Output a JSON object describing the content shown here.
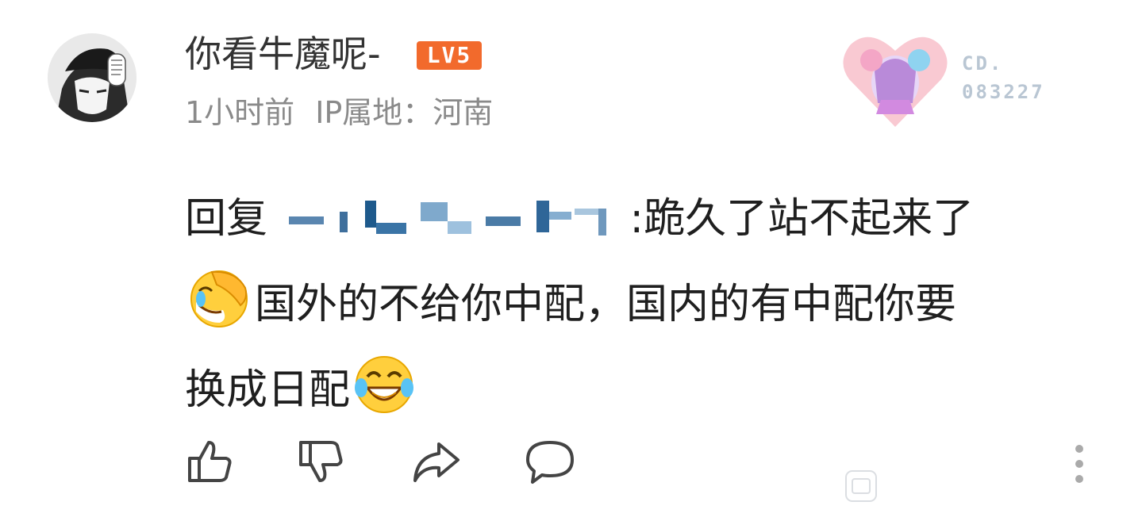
{
  "comment": {
    "username": "你看牛魔呢-",
    "level_badge": "LV5",
    "time": "1小时前",
    "ip_location": "IP属地：河南",
    "decoration_number_top": "CD.",
    "decoration_number_bottom": "083227",
    "reply_prefix": "回复",
    "reply_text_after_mention": ":跪久了站不起来了",
    "line2_text": "国外的不给你中配，国内的有中配你要",
    "line3_text": "换成日配"
  },
  "icons": {
    "line2_emoji": "facepalm-laugh-emoji",
    "line3_emoji": "tears-of-joy-emoji",
    "like": "thumbs-up-icon",
    "dislike": "thumbs-down-icon",
    "share": "share-icon",
    "reply": "comment-icon",
    "more": "more-vertical-icon"
  },
  "colors": {
    "level_badge": "#f26a2c",
    "meta_text": "#8a8a8a",
    "icon_stroke": "#444444",
    "decoration_heart": "#f9c9d2"
  }
}
